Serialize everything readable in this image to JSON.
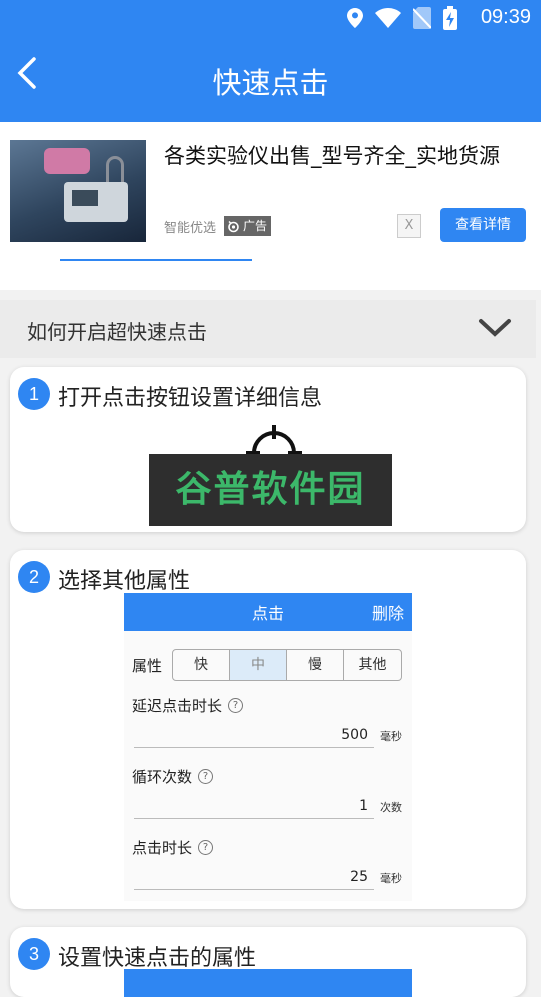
{
  "status_bar": {
    "time": "09:39",
    "icons": [
      "location-icon",
      "wifi-icon",
      "no-sim-icon",
      "battery-charging-icon"
    ]
  },
  "header": {
    "title": "快速点击"
  },
  "ad": {
    "headline": "各类实验仪出售_型号齐全_实地货源",
    "source": "智能优选",
    "tag": "广告",
    "close_label": "X",
    "button_label": "查看详情"
  },
  "howto": {
    "label": "如何开启超快速点击"
  },
  "steps": [
    {
      "number": "1",
      "title": "打开点击按钮设置详细信息",
      "marker_number": "1",
      "watermark": "谷普软件园"
    },
    {
      "number": "2",
      "title": "选择其他属性",
      "panel": {
        "title": "点击",
        "delete_label": "删除",
        "attr_label": "属性",
        "attr_options": [
          "快",
          "中",
          "慢",
          "其他"
        ],
        "selected_option": "中",
        "fields": [
          {
            "label": "延迟点击时长",
            "value": "500",
            "unit": "毫秒"
          },
          {
            "label": "循环次数",
            "value": "1",
            "unit": "次数"
          },
          {
            "label": "点击时长",
            "value": "25",
            "unit": "毫秒"
          }
        ]
      }
    },
    {
      "number": "3",
      "title": "设置快速点击的属性"
    }
  ]
}
